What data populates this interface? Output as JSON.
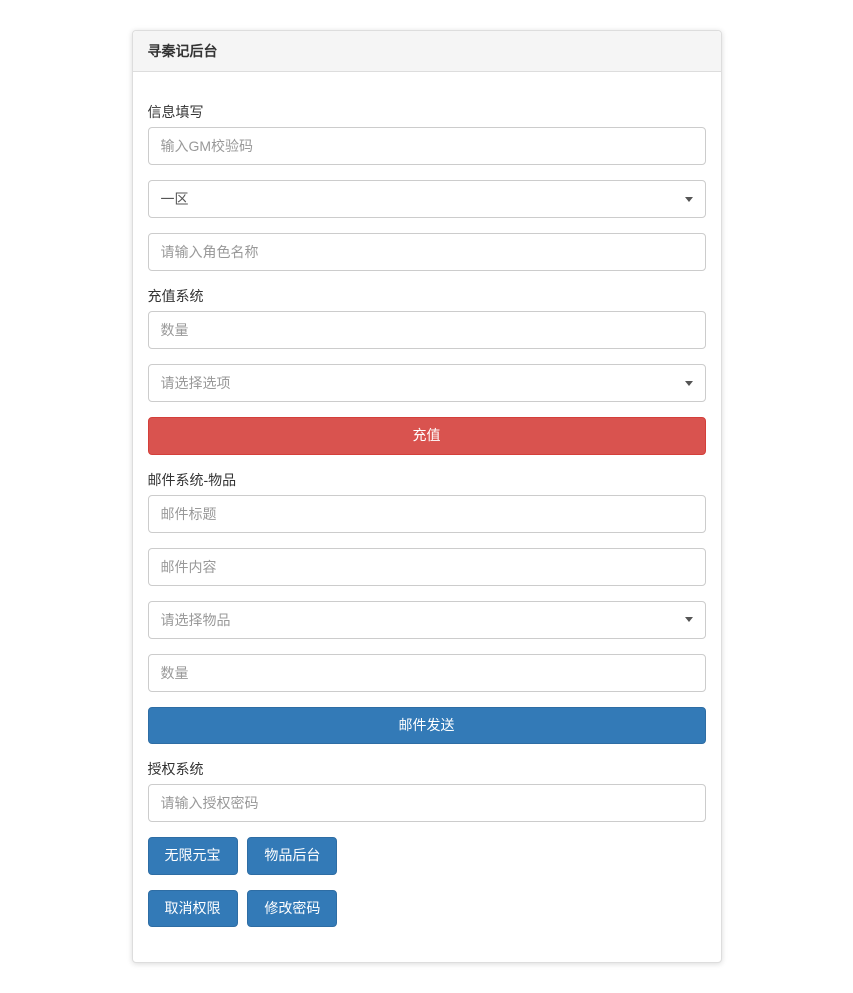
{
  "header": {
    "title": "寻秦记后台"
  },
  "section_info": {
    "label": "信息填写",
    "gm_code_placeholder": "输入GM校验码",
    "server_select": "一区",
    "role_name_placeholder": "请输入角色名称"
  },
  "section_recharge": {
    "label": "充值系统",
    "quantity_placeholder": "数量",
    "option_placeholder": "请选择选项",
    "button": "充值"
  },
  "section_mail": {
    "label": "邮件系统-物品",
    "title_placeholder": "邮件标题",
    "content_placeholder": "邮件内容",
    "item_placeholder": "请选择物品",
    "quantity_placeholder": "数量",
    "button": "邮件发送"
  },
  "section_auth": {
    "label": "授权系统",
    "password_placeholder": "请输入授权密码",
    "buttons": {
      "unlimited_gold": "无限元宝",
      "item_backend": "物品后台",
      "cancel_permission": "取消权限",
      "change_password": "修改密码"
    }
  }
}
